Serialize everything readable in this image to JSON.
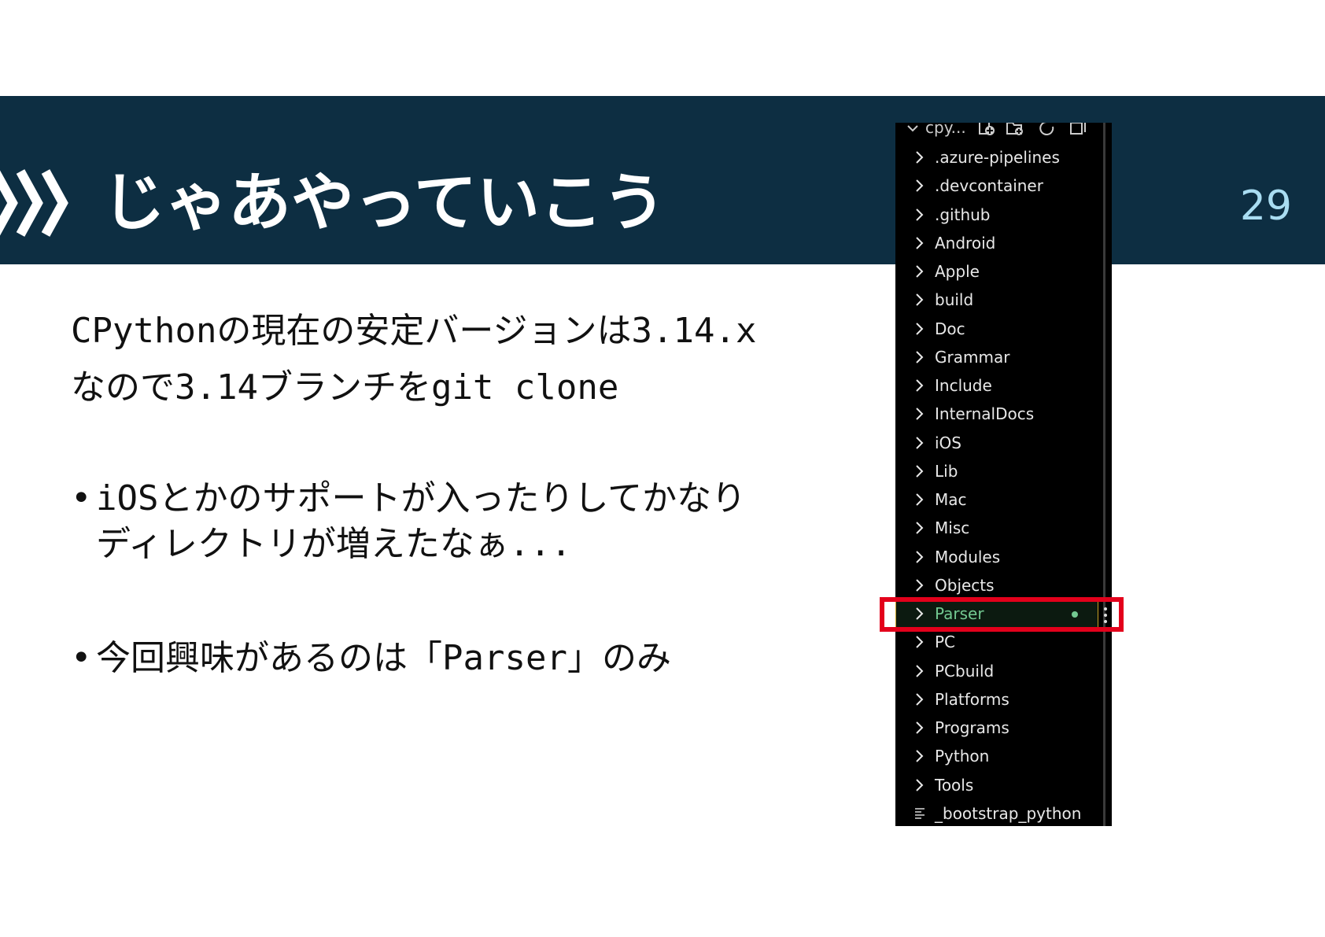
{
  "slide": {
    "title": "じゃあやっていこう",
    "page_number": "29",
    "intro_lines": [
      "CPythonの現在の安定バージョンは3.14.x",
      "なので3.14ブランチをgit clone"
    ],
    "bullets": [
      {
        "marker": "•",
        "lines": [
          "iOSとかのサポートが入ったりしてかなり",
          "ディレクトリが増えたなぁ..."
        ]
      },
      {
        "marker": "•",
        "lines": [
          "今回興味があるのは「Parser」のみ"
        ]
      }
    ],
    "colors": {
      "header_band": "#0d2e42",
      "page_number": "#a9ddf2",
      "highlight": "#e3001b"
    }
  },
  "explorer": {
    "root_label": "cpy...",
    "header_icons": [
      "new-file-icon",
      "new-folder-icon",
      "refresh-icon",
      "collapse-all-icon"
    ],
    "items": [
      {
        "label": ".azure-pipelines",
        "type": "folder"
      },
      {
        "label": ".devcontainer",
        "type": "folder"
      },
      {
        "label": ".github",
        "type": "folder"
      },
      {
        "label": "Android",
        "type": "folder"
      },
      {
        "label": "Apple",
        "type": "folder"
      },
      {
        "label": "build",
        "type": "folder"
      },
      {
        "label": "Doc",
        "type": "folder"
      },
      {
        "label": "Grammar",
        "type": "folder"
      },
      {
        "label": "Include",
        "type": "folder"
      },
      {
        "label": "InternalDocs",
        "type": "folder"
      },
      {
        "label": "iOS",
        "type": "folder"
      },
      {
        "label": "Lib",
        "type": "folder"
      },
      {
        "label": "Mac",
        "type": "folder"
      },
      {
        "label": "Misc",
        "type": "folder"
      },
      {
        "label": "Modules",
        "type": "folder"
      },
      {
        "label": "Objects",
        "type": "folder"
      },
      {
        "label": "Parser",
        "type": "folder",
        "selected": true,
        "modified": true
      },
      {
        "label": "PC",
        "type": "folder"
      },
      {
        "label": "PCbuild",
        "type": "folder"
      },
      {
        "label": "Platforms",
        "type": "folder"
      },
      {
        "label": "Programs",
        "type": "folder"
      },
      {
        "label": "Python",
        "type": "folder"
      },
      {
        "label": "Tools",
        "type": "folder"
      },
      {
        "label": "_bootstrap_python",
        "type": "file"
      }
    ],
    "colors": {
      "background": "#000000",
      "text": "#e8e8e8",
      "selected_text": "#73c991",
      "selected_border": "#c9a227"
    }
  }
}
